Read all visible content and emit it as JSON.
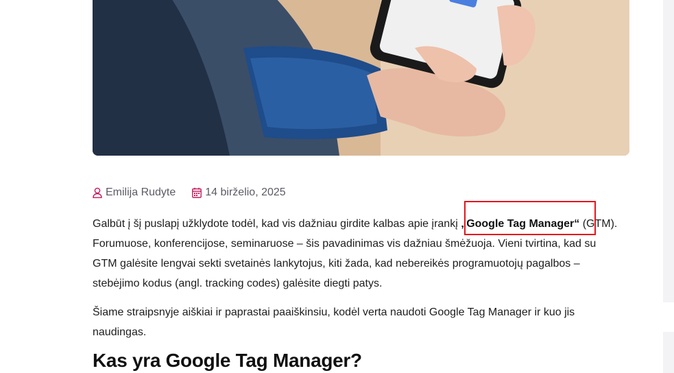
{
  "article": {
    "meta": {
      "author": "Emilija Rudyte",
      "date": "14 birželio, 2025",
      "author_icon": "user-icon",
      "date_icon": "calendar-icon"
    },
    "intro": {
      "before": "Galbūt į šį puslapį užklydote todėl, kad vis dažniau girdite kalbas apie įrankį ",
      "highlight": "„Google Tag Manager“",
      "after": " (GTM). Forumuose, konferencijose, seminaruose – šis pavadinimas vis dažniau šmėžuoja. Vieni tvirtina, kad su GTM galėsite lengvai sekti svetainės lankytojus, kiti žada, kad nebereikės programuotojų pagalbos – stebėjimo kodus (angl. tracking codes) galėsite diegti patys."
    },
    "paragraph2": "Šiame straipsnyje aiškiai ir paprastai paaiškinsiu, kodėl verta naudoti Google Tag Manager ir kuo jis naudingas.",
    "heading": "Kas yra Google Tag Manager?"
  },
  "colors": {
    "accent": "#c2185b",
    "highlight_border": "#e4141b"
  }
}
